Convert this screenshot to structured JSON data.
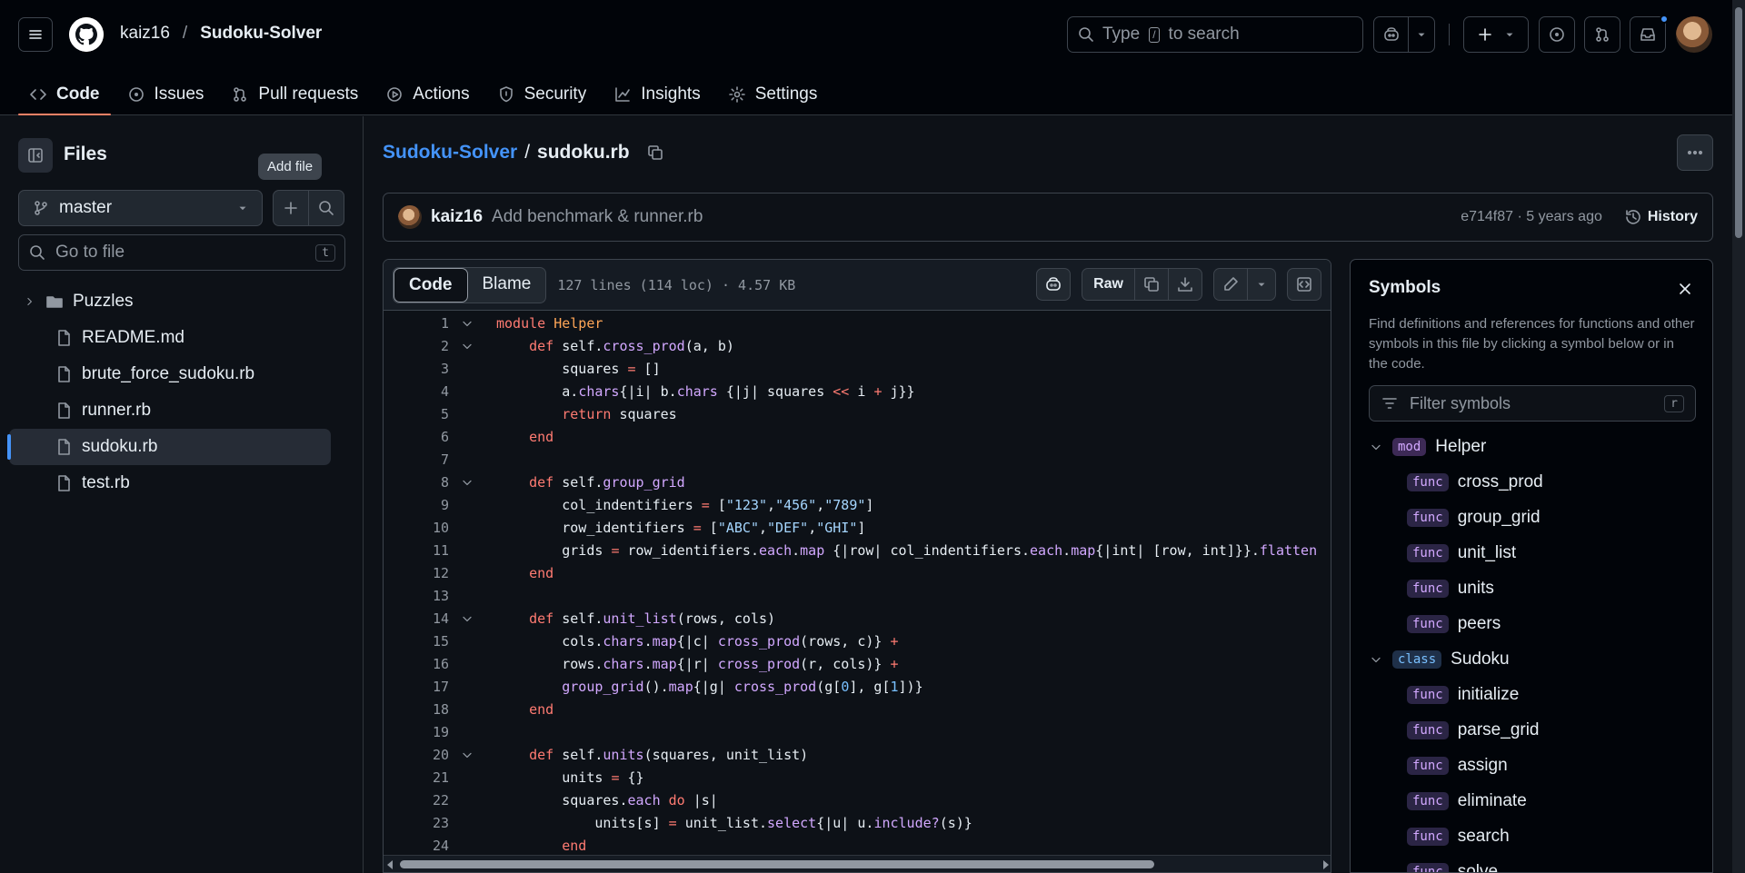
{
  "header": {
    "owner": "kaiz16",
    "separator": "/",
    "repo": "Sudoku-Solver",
    "search_prefix": "Type",
    "search_key": "/",
    "search_suffix": "to search"
  },
  "tabs": [
    {
      "label": "Code",
      "icon": "code-icon"
    },
    {
      "label": "Issues",
      "icon": "issue-icon"
    },
    {
      "label": "Pull requests",
      "icon": "pull-request-icon"
    },
    {
      "label": "Actions",
      "icon": "play-icon"
    },
    {
      "label": "Security",
      "icon": "shield-icon"
    },
    {
      "label": "Insights",
      "icon": "graph-icon"
    },
    {
      "label": "Settings",
      "icon": "gear-icon"
    }
  ],
  "sidebar": {
    "title": "Files",
    "tooltip": "Add file",
    "branch": "master",
    "goto_placeholder": "Go to file",
    "goto_key": "t",
    "items": [
      {
        "label": "Puzzles",
        "type": "folder"
      },
      {
        "label": "README.md",
        "type": "file"
      },
      {
        "label": "brute_force_sudoku.rb",
        "type": "file"
      },
      {
        "label": "runner.rb",
        "type": "file"
      },
      {
        "label": "sudoku.rb",
        "type": "file",
        "selected": true
      },
      {
        "label": "test.rb",
        "type": "file"
      }
    ]
  },
  "main": {
    "repo_link": "Sudoku-Solver",
    "sep": "/",
    "file": "sudoku.rb",
    "commit": {
      "author": "kaiz16",
      "message": "Add benchmark & runner.rb",
      "meta": "e714f87 · 5 years ago",
      "history": "History"
    },
    "code_tab": "Code",
    "blame_tab": "Blame",
    "info": "127 lines (114 loc) · 4.57 KB",
    "raw": "Raw"
  },
  "code_lines": [
    {
      "n": "1",
      "fold": true,
      "html": "<span class=\"kw\">module</span> <span class=\"cls\">Helper</span>"
    },
    {
      "n": "2",
      "fold": true,
      "html": "    <span class=\"kw\">def</span> self.<span class=\"ent\">cross_prod</span>(a, b)"
    },
    {
      "n": "3",
      "fold": false,
      "html": "        squares <span class=\"kw\">=</span> []"
    },
    {
      "n": "4",
      "fold": false,
      "html": "        a.<span class=\"ent\">chars</span>{|i| b.<span class=\"ent\">chars</span> {|j| squares <span class=\"kw\">&lt;&lt;</span> i <span class=\"kw\">+</span> j}}"
    },
    {
      "n": "5",
      "fold": false,
      "html": "        <span class=\"kw\">return</span> squares"
    },
    {
      "n": "6",
      "fold": false,
      "html": "    <span class=\"kw\">end</span>"
    },
    {
      "n": "7",
      "fold": false,
      "html": ""
    },
    {
      "n": "8",
      "fold": true,
      "html": "    <span class=\"kw\">def</span> self.<span class=\"ent\">group_grid</span>"
    },
    {
      "n": "9",
      "fold": false,
      "html": "        col_indentifiers <span class=\"kw\">=</span> [<span class=\"str\">\"123\"</span>,<span class=\"str\">\"456\"</span>,<span class=\"str\">\"789\"</span>]"
    },
    {
      "n": "10",
      "fold": false,
      "html": "        row_identifiers <span class=\"kw\">=</span> [<span class=\"str\">\"ABC\"</span>,<span class=\"str\">\"DEF\"</span>,<span class=\"str\">\"GHI\"</span>]"
    },
    {
      "n": "11",
      "fold": false,
      "html": "        grids <span class=\"kw\">=</span> row_identifiers.<span class=\"ent\">each</span>.<span class=\"ent\">map</span> {|row| col_indentifiers.<span class=\"ent\">each</span>.<span class=\"ent\">map</span>{|int| [row, int]}}.<span class=\"ent\">flatten</span>"
    },
    {
      "n": "12",
      "fold": false,
      "html": "    <span class=\"kw\">end</span>"
    },
    {
      "n": "13",
      "fold": false,
      "html": ""
    },
    {
      "n": "14",
      "fold": true,
      "html": "    <span class=\"kw\">def</span> self.<span class=\"ent\">unit_list</span>(rows, cols)"
    },
    {
      "n": "15",
      "fold": false,
      "html": "        cols.<span class=\"ent\">chars</span>.<span class=\"ent\">map</span>{|c| <span class=\"ent\">cross_prod</span>(rows, c)} <span class=\"kw\">+</span>"
    },
    {
      "n": "16",
      "fold": false,
      "html": "        rows.<span class=\"ent\">chars</span>.<span class=\"ent\">map</span>{|r| <span class=\"ent\">cross_prod</span>(r, cols)} <span class=\"kw\">+</span>"
    },
    {
      "n": "17",
      "fold": false,
      "html": "        <span class=\"ent\">group_grid</span>().<span class=\"ent\">map</span>{|g| <span class=\"ent\">cross_prod</span>(g[<span class=\"num\">0</span>], g[<span class=\"num\">1</span>])}"
    },
    {
      "n": "18",
      "fold": false,
      "html": "    <span class=\"kw\">end</span>"
    },
    {
      "n": "19",
      "fold": false,
      "html": ""
    },
    {
      "n": "20",
      "fold": true,
      "html": "    <span class=\"kw\">def</span> self.<span class=\"ent\">units</span>(squares, unit_list)"
    },
    {
      "n": "21",
      "fold": false,
      "html": "        units <span class=\"kw\">=</span> {}"
    },
    {
      "n": "22",
      "fold": false,
      "html": "        squares.<span class=\"ent\">each</span> <span class=\"kw\">do</span> |s|"
    },
    {
      "n": "23",
      "fold": false,
      "html": "            units[s] <span class=\"kw\">=</span> unit_list.<span class=\"ent\">select</span>{|u| u.<span class=\"ent\">include?</span>(s)}"
    },
    {
      "n": "24",
      "fold": false,
      "html": "        <span class=\"kw\">end</span>"
    }
  ],
  "symbols": {
    "title": "Symbols",
    "description": "Find definitions and references for functions and other symbols in this file by clicking a symbol below or in the code.",
    "filter_placeholder": "Filter symbols",
    "filter_key": "r",
    "items": [
      {
        "kind": "mod",
        "name": "Helper",
        "child": false
      },
      {
        "kind": "func",
        "name": "cross_prod",
        "child": true
      },
      {
        "kind": "func",
        "name": "group_grid",
        "child": true
      },
      {
        "kind": "func",
        "name": "unit_list",
        "child": true
      },
      {
        "kind": "func",
        "name": "units",
        "child": true
      },
      {
        "kind": "func",
        "name": "peers",
        "child": true
      },
      {
        "kind": "class",
        "name": "Sudoku",
        "child": false
      },
      {
        "kind": "func",
        "name": "initialize",
        "child": true
      },
      {
        "kind": "func",
        "name": "parse_grid",
        "child": true
      },
      {
        "kind": "func",
        "name": "assign",
        "child": true
      },
      {
        "kind": "func",
        "name": "eliminate",
        "child": true
      },
      {
        "kind": "func",
        "name": "search",
        "child": true
      },
      {
        "kind": "func",
        "name": "solve",
        "child": true
      }
    ]
  },
  "colors": {
    "background": "#0d1117",
    "header": "#010409",
    "accent_link": "#4493f8",
    "tab_underline": "#f78166",
    "border": "#3d444d"
  }
}
